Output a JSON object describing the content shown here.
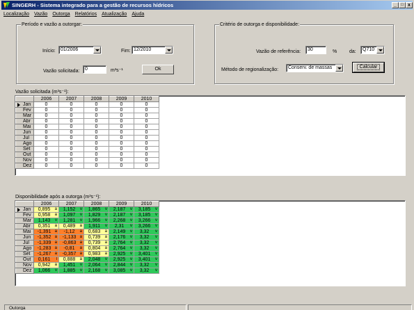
{
  "window": {
    "title": "SINGERH - Sistema integrado para a gestão de recursos hídricos",
    "minimize": "_",
    "maximize": "□",
    "close": "x"
  },
  "menu": [
    "Localização",
    "Vazão",
    "Outorga",
    "Relatórios",
    "Atualização",
    "Ajuda"
  ],
  "period": {
    "legend": "Período e vazão a outorgar:",
    "start_label": "Início:",
    "start_value": "01/2006",
    "end_label": "Fim:",
    "end_value": "12/2010",
    "flow_label": "Vazão solicitada:",
    "flow_value": "0",
    "flow_unit": "m³s⁻¹",
    "ok_label": "Ok"
  },
  "criteria": {
    "legend": "Critério de outorga e disponibilidade:",
    "ref_label": "Vazão de referência:",
    "ref_value": "30",
    "pct": "%",
    "da_label": "da:",
    "da_value": "Q710",
    "method_label": "Método de regionalização:",
    "method_value": "Conserv. de massas",
    "calc_label": "Calcular"
  },
  "requested": {
    "caption": "Vazão solicitada (m³s⁻¹):",
    "years": [
      "2006",
      "2007",
      "2008",
      "2009",
      "2010"
    ],
    "months": [
      "Jan",
      "Fev",
      "Mar",
      "Abr",
      "Mai",
      "Jun",
      "Jul",
      "Ago",
      "Set",
      "Out",
      "Nov",
      "Dez"
    ],
    "value": "0"
  },
  "availability": {
    "caption": "Disponibilidade após a outorga (m³s⁻¹):",
    "years": [
      "2006",
      "2007",
      "2008",
      "2009",
      "2010"
    ],
    "rows": [
      [
        [
          "0,895",
          "a"
        ],
        [
          "1,152",
          "v"
        ],
        [
          "1,865",
          "v"
        ],
        [
          "2,187",
          "v"
        ],
        [
          "3,185",
          "v"
        ]
      ],
      [
        [
          "0,958",
          "a"
        ],
        [
          "1,097",
          "v"
        ],
        [
          "1,829",
          "v"
        ],
        [
          "2,187",
          "v"
        ],
        [
          "3,185",
          "v"
        ]
      ],
      [
        [
          "1,143",
          "v"
        ],
        [
          "1,281",
          "v"
        ],
        [
          "1,966",
          "v"
        ],
        [
          "2,268",
          "v"
        ],
        [
          "3,266",
          "v"
        ]
      ],
      [
        [
          "0,351",
          "a"
        ],
        [
          "0,489",
          "a"
        ],
        [
          "1,911",
          "v"
        ],
        [
          "2,31",
          "v"
        ],
        [
          "3,266",
          "v"
        ]
      ],
      [
        [
          "-1,391",
          "a"
        ],
        [
          "-1,12",
          "a"
        ],
        [
          "0,683",
          "a"
        ],
        [
          "2,149",
          "v"
        ],
        [
          "3,32",
          "v"
        ]
      ],
      [
        [
          "-1,352",
          "a"
        ],
        [
          "-1,133",
          "a"
        ],
        [
          "0,739",
          "a"
        ],
        [
          "2,176",
          "v"
        ],
        [
          "3,32",
          "v"
        ]
      ],
      [
        [
          "-1,339",
          "a"
        ],
        [
          "-0,863",
          "a"
        ],
        [
          "0,739",
          "a"
        ],
        [
          "2,764",
          "v"
        ],
        [
          "3,32",
          "v"
        ]
      ],
      [
        [
          "-1,283",
          "a"
        ],
        [
          "-0,81",
          "a"
        ],
        [
          "0,804",
          "a"
        ],
        [
          "2,764",
          "v"
        ],
        [
          "3,32",
          "v"
        ]
      ],
      [
        [
          "-1,267",
          "a"
        ],
        [
          "-0,357",
          "a"
        ],
        [
          "0,983",
          "a"
        ],
        [
          "2,925",
          "v"
        ],
        [
          "3,401",
          "v"
        ]
      ],
      [
        [
          "0,161",
          "l"
        ],
        [
          "0,888",
          "a"
        ],
        [
          "2,048",
          "v"
        ],
        [
          "2,925",
          "v"
        ],
        [
          "3,401",
          "v"
        ]
      ],
      [
        [
          "0,942",
          "a"
        ],
        [
          "1,451",
          "v"
        ],
        [
          "2,064",
          "v"
        ],
        [
          "2,844",
          "v"
        ],
        [
          "3,32",
          "v"
        ]
      ],
      [
        [
          "1,066",
          "v"
        ],
        [
          "1,885",
          "v"
        ],
        [
          "2,168",
          "v"
        ],
        [
          "3,085",
          "v"
        ],
        [
          "3,32",
          "v"
        ]
      ]
    ]
  },
  "colors": {
    "yellow": "#ffff99",
    "green": "#2ec95a",
    "orange": "#ff7f2a",
    "title_start": "#0a246a",
    "title_end": "#a6caf0"
  },
  "status": {
    "panel1": "Outorga"
  }
}
